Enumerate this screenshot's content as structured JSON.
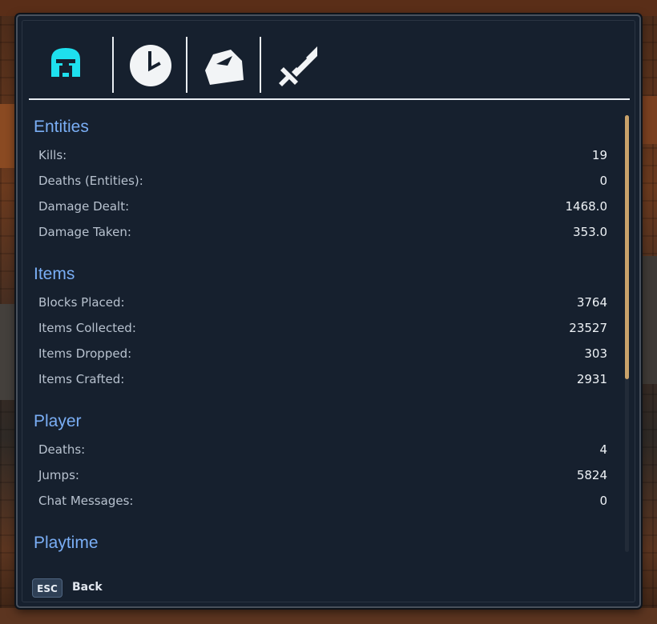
{
  "colors": {
    "accent_section": "#7aaef5",
    "panel_bg": "#16202e",
    "active_tab": "#1ee0ee",
    "scroll_thumb": "#c9a26a"
  },
  "tabs": [
    {
      "icon": "helmet-icon",
      "active": true
    },
    {
      "icon": "clock-icon",
      "active": false
    },
    {
      "icon": "stone-icon",
      "active": false
    },
    {
      "icon": "sword-icon",
      "active": false
    }
  ],
  "sections": [
    {
      "title": "Entities",
      "rows": [
        {
          "label": "Kills:",
          "value": "19"
        },
        {
          "label": "Deaths (Entities):",
          "value": "0"
        },
        {
          "label": "Damage Dealt:",
          "value": "1468.0"
        },
        {
          "label": "Damage Taken:",
          "value": "353.0"
        }
      ]
    },
    {
      "title": "Items",
      "rows": [
        {
          "label": "Blocks Placed:",
          "value": "3764"
        },
        {
          "label": "Items Collected:",
          "value": "23527"
        },
        {
          "label": "Items Dropped:",
          "value": "303"
        },
        {
          "label": "Items Crafted:",
          "value": "2931"
        }
      ]
    },
    {
      "title": "Player",
      "rows": [
        {
          "label": "Deaths:",
          "value": "4"
        },
        {
          "label": "Jumps:",
          "value": "5824"
        },
        {
          "label": "Chat Messages:",
          "value": "0"
        }
      ]
    },
    {
      "title": "Playtime",
      "rows": []
    }
  ],
  "footer": {
    "key": "ESC",
    "label": "Back"
  }
}
